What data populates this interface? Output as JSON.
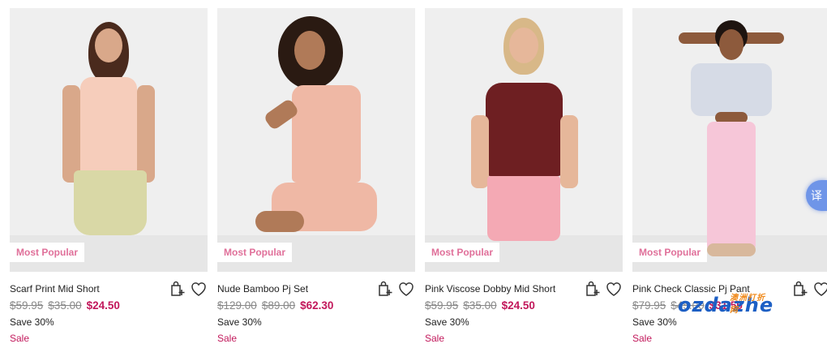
{
  "products": [
    {
      "name": "Scarf Print Mid Short",
      "was": [
        "$59.95",
        "$35.00"
      ],
      "now": "$24.50",
      "save": "Save 30%",
      "sale": "Sale",
      "badge": "Most Popular",
      "colors": {
        "top": "#f6cdbb",
        "bottom": "#d9d8a6",
        "hair": "#4a2a1d"
      }
    },
    {
      "name": "Nude Bamboo Pj Set",
      "was": [
        "$129.00",
        "$89.00"
      ],
      "now": "$62.30",
      "save": "Save 30%",
      "sale": "Sale",
      "badge": "Most Popular",
      "colors": {
        "top": "#efb8a5",
        "bottom": "#efb8a5",
        "hair": "#2a1a12"
      }
    },
    {
      "name": "Pink Viscose Dobby Mid Short",
      "was": [
        "$59.95",
        "$35.00"
      ],
      "now": "$24.50",
      "save": "Save 30%",
      "sale": "Sale",
      "badge": "Most Popular",
      "colors": {
        "top": "#6e1f22",
        "bottom": "#f4a9b4",
        "hair": "#d8b888"
      }
    },
    {
      "name": "Pink Check Classic Pj Pant",
      "was": [
        "$79.95",
        "$45.00"
      ],
      "now": "$31.50",
      "save": "Save 30%",
      "sale": "Sale",
      "badge": "Most Popular",
      "colors": {
        "top": "#d6dbe6",
        "bottom": "#f6c6d8",
        "hair": "#1e1410"
      }
    }
  ],
  "icons": {
    "bag": "add-to-bag-icon",
    "wish": "heart-icon"
  },
  "overlay": {
    "translate_tab": "译",
    "watermark": "ozdazhe",
    "watermark_sub": "澳洲打折网"
  }
}
